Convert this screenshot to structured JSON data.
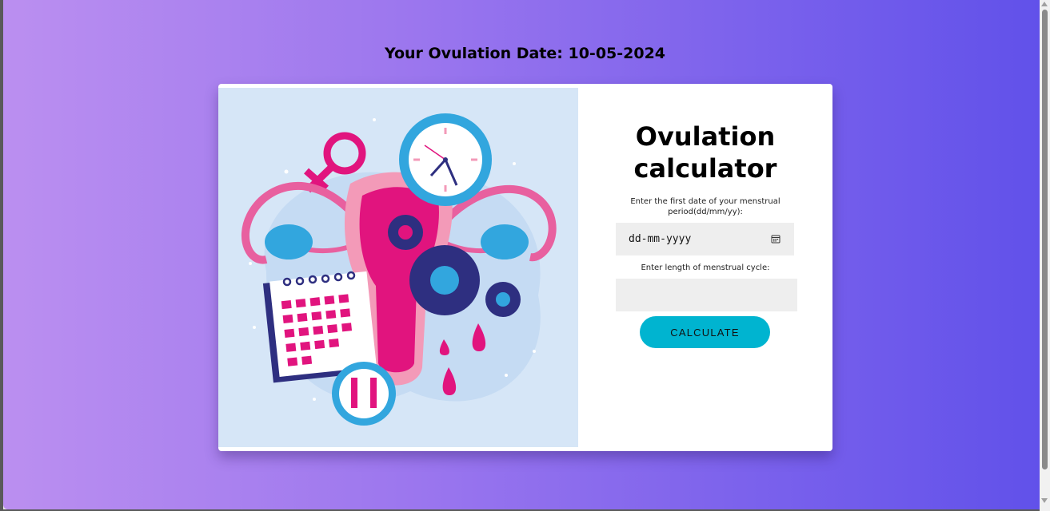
{
  "result": {
    "heading": "Your Ovulation Date: 10-05-2024"
  },
  "illustration": {
    "icon": "uterus-clock-calendar-illustration",
    "colors": {
      "background": "#d6e6f7",
      "pink": "#e6137a",
      "blue": "#32a6de",
      "navy": "#2e2f80"
    }
  },
  "form": {
    "title": "Ovulation calculator",
    "date_label": "Enter the first date of your menstrual period(dd/mm/yy):",
    "date_placeholder": "dd-mm-yyyy",
    "date_icon": "calendar-icon",
    "cycle_label": "Enter length of menstrual cycle:",
    "cycle_value": "",
    "calculate_label": "CALCULATE"
  },
  "colors": {
    "gradient_start": "#bb8ff0",
    "gradient_end": "#6151ea",
    "button": "#00b4d0",
    "field_background": "#eeeeee"
  }
}
